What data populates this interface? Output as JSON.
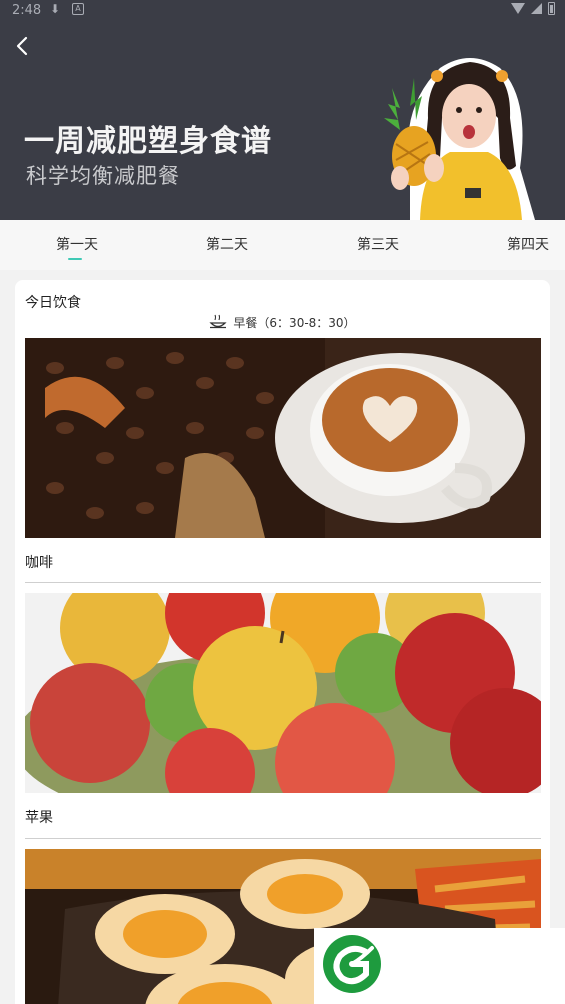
{
  "status_bar": {
    "time": "2:48",
    "download_icon": "download-icon",
    "notification_icon": "a-icon"
  },
  "header": {
    "back_icon": "chevron-left-icon",
    "title": "一周减肥塑身食谱",
    "subtitle": "科学均衡减肥餐"
  },
  "tabs": [
    {
      "label": "第一天",
      "active": true
    },
    {
      "label": "第二天",
      "active": false
    },
    {
      "label": "第三天",
      "active": false
    },
    {
      "label": "第四天",
      "active": false
    }
  ],
  "card": {
    "title": "今日饮食",
    "meal": {
      "icon": "meal-bowl-icon",
      "label": "早餐（6：30-8：30）"
    },
    "foods": [
      {
        "name": "咖啡",
        "image": "coffee-photo"
      },
      {
        "name": "苹果",
        "image": "apple-photo"
      },
      {
        "name": "",
        "image": "egg-photo"
      }
    ]
  },
  "colors": {
    "banner_bg": "#3b3d46",
    "accent": "#3fc9b5",
    "logo_green": "#1e9b3e"
  }
}
